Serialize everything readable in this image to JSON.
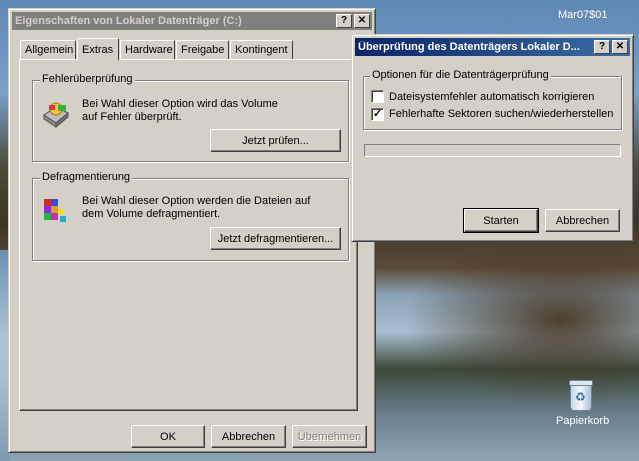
{
  "desktop": {
    "clock": "Mar07$01",
    "recycle_bin_label": "Papierkorb"
  },
  "properties_window": {
    "title": "Eigenschaften von Lokaler Datenträger (C:)",
    "help_btn": "?",
    "close_btn": "✕",
    "tabs": [
      {
        "label": "Allgemein"
      },
      {
        "label": "Extras",
        "selected": true
      },
      {
        "label": "Hardware"
      },
      {
        "label": "Freigabe"
      },
      {
        "label": "Kontingent"
      }
    ],
    "error_check": {
      "legend": "Fehlerüberprüfung",
      "text_line1": "Bei Wahl dieser Option wird das Volume",
      "text_line2": "auf Fehler überprüft.",
      "button": "Jetzt prüfen..."
    },
    "defrag": {
      "legend": "Defragmentierung",
      "text_line1": "Bei Wahl dieser Option werden die Dateien auf",
      "text_line2": "dem Volume defragmentiert.",
      "button": "Jetzt defragmentieren..."
    },
    "buttons": {
      "ok": "OK",
      "cancel": "Abbrechen",
      "apply": "Übernehmen"
    }
  },
  "check_dialog": {
    "title": "Überprüfung des Datenträgers Lokaler D...",
    "help_btn": "?",
    "close_btn": "✕",
    "options_legend": "Optionen für die Datenträgerprüfung",
    "options": [
      {
        "label": "Dateisystemfehler automatisch korrigieren",
        "checked": false
      },
      {
        "label": "Fehlerhafte Sektoren suchen/wiederherstellen",
        "checked": true
      }
    ],
    "progress": 0,
    "buttons": {
      "start": "Starten",
      "cancel": "Abbrechen"
    }
  },
  "icons": [
    "disk-check-icon",
    "defrag-icon",
    "recycle-bin-icon",
    "help-icon",
    "close-icon"
  ]
}
